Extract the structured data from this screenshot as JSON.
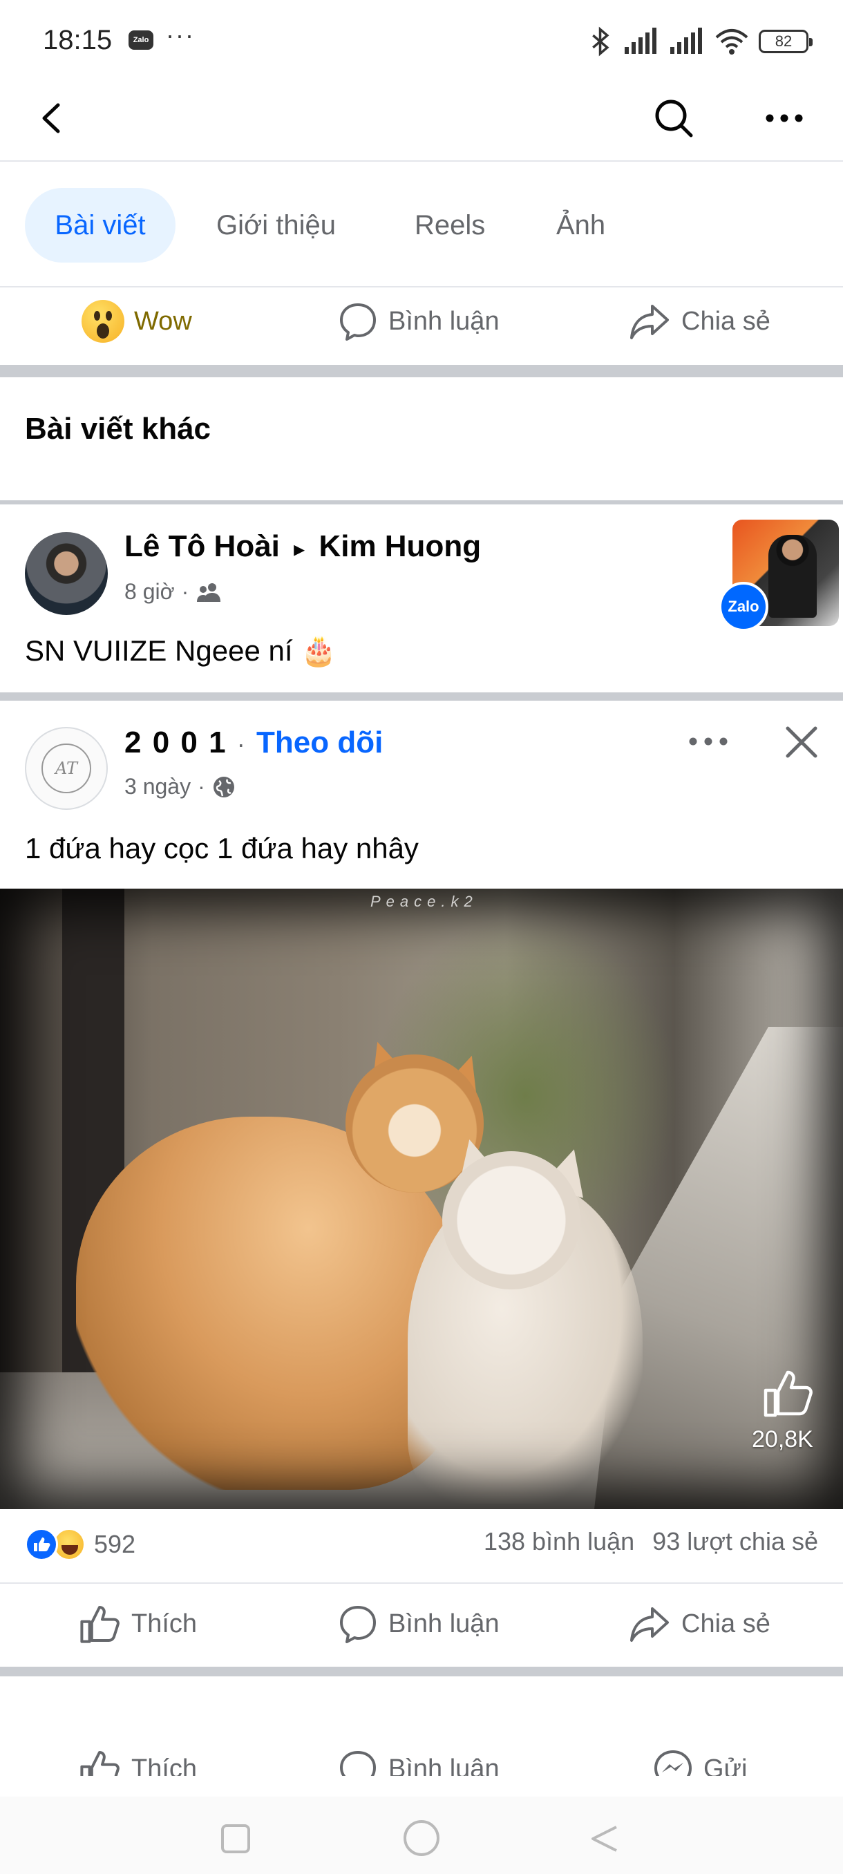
{
  "status_bar": {
    "time": "18:15",
    "zalo_label": "Zalo",
    "overflow": "···",
    "battery": "82"
  },
  "tabs": [
    {
      "label": "Bài viết"
    },
    {
      "label": "Giới thiệu"
    },
    {
      "label": "Reels"
    },
    {
      "label": "Ảnh"
    }
  ],
  "prev_post_actions": {
    "reaction_label": "Wow",
    "comment_label": "Bình luận",
    "share_label": "Chia sẻ"
  },
  "section_title": "Bài viết khác",
  "post1": {
    "author": "Lê Tô Hoài",
    "arrow": "▸",
    "target": "Kim Huong",
    "time": "8 giờ",
    "text": "SN VUIIZE Ngeee ní 🎂",
    "badge": "Zalo"
  },
  "post2": {
    "author": "2 0 0 1",
    "separator": "·",
    "follow_label": "Theo dõi",
    "time": "3 ngày",
    "text": "1 đứa hay cọc 1 đứa hay nhây",
    "avatar_text": "AT",
    "video_watermark": "Peace.k2",
    "video_likes": "20,8K",
    "reaction_count": "592",
    "comments": "138 bình luận",
    "shares": "93 lượt chia sẻ",
    "actions": {
      "like_label": "Thích",
      "comment_label": "Bình luận",
      "share_label": "Chia sẻ"
    }
  },
  "post3_actions": {
    "like_label": "Thích",
    "comment_label": "Bình luận",
    "send_label": "Gửi"
  },
  "colors": {
    "accent": "#0866ff",
    "secondary_text": "#65676b",
    "wow_text": "#7f6a00"
  }
}
